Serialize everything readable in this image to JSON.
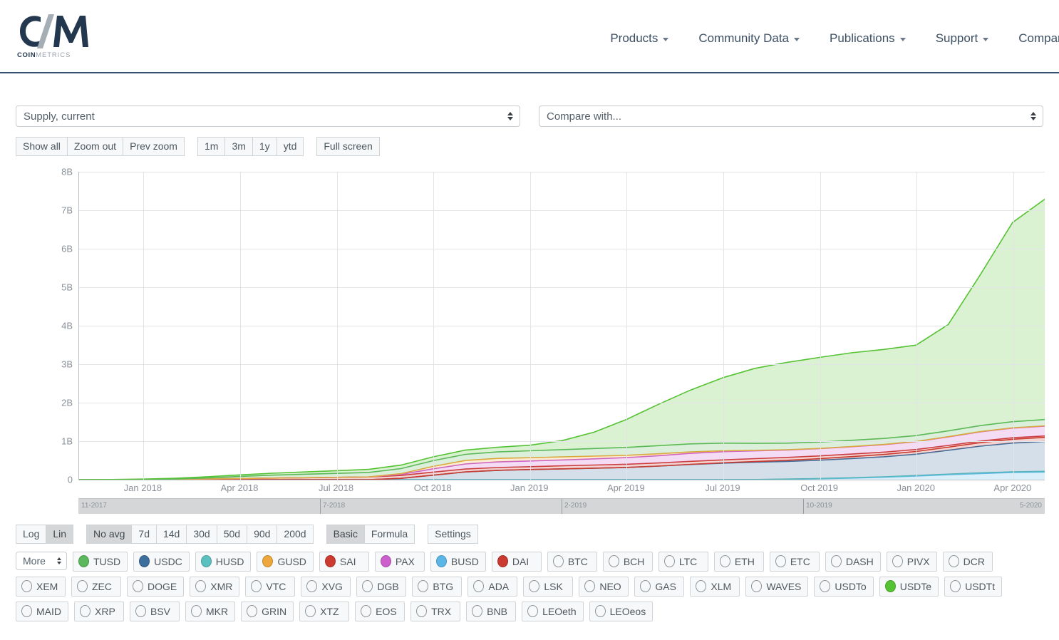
{
  "header": {
    "logo_text_bold": "COIN",
    "logo_text_light": "METRICS",
    "nav": [
      {
        "label": "Products",
        "caret": true
      },
      {
        "label": "Community Data",
        "caret": true
      },
      {
        "label": "Publications",
        "caret": true
      },
      {
        "label": "Support",
        "caret": true
      },
      {
        "label": "Company",
        "caret": true
      }
    ]
  },
  "selects": {
    "metric": {
      "value": "Supply, current",
      "name": "metric-select"
    },
    "compare": {
      "value": "Compare with...",
      "name": "compare-select"
    }
  },
  "toolbar": {
    "zoom_group": [
      "Show all",
      "Zoom out",
      "Prev zoom"
    ],
    "range_group": [
      "1m",
      "3m",
      "1y",
      "ytd"
    ],
    "fullscreen": "Full screen"
  },
  "lower_toolbar": {
    "scale_group": [
      "Log",
      "Lin"
    ],
    "scale_active": "Lin",
    "avg_group": [
      "No avg",
      "7d",
      "14d",
      "30d",
      "50d",
      "90d",
      "200d"
    ],
    "avg_active": "No avg",
    "mode_group": [
      "Basic",
      "Formula"
    ],
    "mode_active": "Basic",
    "settings": "Settings"
  },
  "asset_picker": {
    "more_label": "More",
    "rows": [
      [
        {
          "label": "TUSD",
          "active": true,
          "color": "#5cb85c"
        },
        {
          "label": "USDC",
          "active": true,
          "color": "#3d6f9e"
        },
        {
          "label": "HUSD",
          "active": true,
          "color": "#5bc0c0"
        },
        {
          "label": "GUSD",
          "active": true,
          "color": "#eda73c"
        },
        {
          "label": "SAI",
          "active": true,
          "color": "#cc3a30"
        },
        {
          "label": "PAX",
          "active": true,
          "color": "#cc5fcc"
        },
        {
          "label": "BUSD",
          "active": true,
          "color": "#5bb6e8"
        },
        {
          "label": "DAI",
          "active": true,
          "color": "#c93a30"
        },
        {
          "label": "BTC",
          "active": false,
          "color": null
        },
        {
          "label": "BCH",
          "active": false,
          "color": null
        },
        {
          "label": "LTC",
          "active": false,
          "color": null
        },
        {
          "label": "ETH",
          "active": false,
          "color": null
        },
        {
          "label": "ETC",
          "active": false,
          "color": null
        },
        {
          "label": "DASH",
          "active": false,
          "color": null
        },
        {
          "label": "PIVX",
          "active": false,
          "color": null
        },
        {
          "label": "DCR",
          "active": false,
          "color": null
        }
      ],
      [
        {
          "label": "XEM",
          "active": false,
          "color": null
        },
        {
          "label": "ZEC",
          "active": false,
          "color": null
        },
        {
          "label": "DOGE",
          "active": false,
          "color": null
        },
        {
          "label": "XMR",
          "active": false,
          "color": null
        },
        {
          "label": "VTC",
          "active": false,
          "color": null
        },
        {
          "label": "XVG",
          "active": false,
          "color": null
        },
        {
          "label": "DGB",
          "active": false,
          "color": null
        },
        {
          "label": "BTG",
          "active": false,
          "color": null
        },
        {
          "label": "ADA",
          "active": false,
          "color": null
        },
        {
          "label": "LSK",
          "active": false,
          "color": null
        },
        {
          "label": "NEO",
          "active": false,
          "color": null
        },
        {
          "label": "GAS",
          "active": false,
          "color": null
        },
        {
          "label": "XLM",
          "active": false,
          "color": null
        },
        {
          "label": "WAVES",
          "active": false,
          "color": null
        },
        {
          "label": "USDTo",
          "active": false,
          "color": null
        },
        {
          "label": "USDTe",
          "active": true,
          "color": "#55c233"
        },
        {
          "label": "USDTt",
          "active": false,
          "color": null
        }
      ],
      [
        {
          "label": "MAID",
          "active": false,
          "color": null
        },
        {
          "label": "XRP",
          "active": false,
          "color": null
        },
        {
          "label": "BSV",
          "active": false,
          "color": null
        },
        {
          "label": "MKR",
          "active": false,
          "color": null
        },
        {
          "label": "GRIN",
          "active": false,
          "color": null
        },
        {
          "label": "XTZ",
          "active": false,
          "color": null
        },
        {
          "label": "EOS",
          "active": false,
          "color": null
        },
        {
          "label": "TRX",
          "active": false,
          "color": null
        },
        {
          "label": "BNB",
          "active": false,
          "color": null
        },
        {
          "label": "LEOeth",
          "active": false,
          "color": null
        },
        {
          "label": "LEOeos",
          "active": false,
          "color": null
        }
      ]
    ]
  },
  "navigator": {
    "labels": [
      "11-2017",
      "7-2018",
      "2-2019",
      "10-2019",
      "5-2020"
    ],
    "tick_positions_pct": [
      0,
      49.5,
      99.5
    ]
  },
  "chart_data": {
    "type": "area",
    "title": "Supply, current",
    "xlabel": "",
    "ylabel": "",
    "ylim": [
      0,
      8000000000
    ],
    "ytick_labels": [
      "0",
      "1B",
      "2B",
      "3B",
      "4B",
      "5B",
      "6B",
      "7B",
      "8B"
    ],
    "ytick_values": [
      0,
      1000000000,
      2000000000,
      3000000000,
      4000000000,
      5000000000,
      6000000000,
      7000000000,
      8000000000
    ],
    "xtick_labels": [
      "Jan 2018",
      "Apr 2018",
      "Jul 2018",
      "Oct 2018",
      "Jan 2019",
      "Apr 2019",
      "Jul 2019",
      "Oct 2019",
      "Jan 2020",
      "Apr 2020"
    ],
    "grid": true,
    "legend": "chips-below",
    "stacked": true,
    "x": [
      "2017-11",
      "2017-12",
      "2018-01",
      "2018-02",
      "2018-03",
      "2018-04",
      "2018-05",
      "2018-06",
      "2018-07",
      "2018-08",
      "2018-09",
      "2018-10",
      "2018-11",
      "2018-12",
      "2019-01",
      "2019-02",
      "2019-03",
      "2019-04",
      "2019-05",
      "2019-06",
      "2019-07",
      "2019-08",
      "2019-09",
      "2019-10",
      "2019-11",
      "2019-12",
      "2020-01",
      "2020-02",
      "2020-03",
      "2020-04",
      "2020-05"
    ],
    "series": [
      {
        "name": "BUSD",
        "color": "#5bb6e8",
        "values": [
          0,
          0,
          0,
          0,
          0,
          0,
          0,
          0,
          0,
          0,
          0,
          0,
          0,
          0,
          0,
          0,
          0,
          0,
          0,
          0,
          0,
          0,
          10000000,
          20000000,
          40000000,
          60000000,
          90000000,
          130000000,
          160000000,
          190000000,
          200000000
        ]
      },
      {
        "name": "HUSD",
        "color": "#5bc0c0",
        "values": [
          0,
          0,
          0,
          0,
          0,
          0,
          0,
          0,
          0,
          0,
          0,
          0,
          0,
          0,
          0,
          0,
          0,
          0,
          0,
          0,
          0,
          0,
          5000000,
          8000000,
          10000000,
          12000000,
          14000000,
          16000000,
          18000000,
          20000000,
          20000000
        ]
      },
      {
        "name": "USDC",
        "color": "#3d6f9e",
        "values": [
          0,
          0,
          0,
          0,
          0,
          0,
          0,
          0,
          0,
          0,
          0,
          130000000,
          210000000,
          250000000,
          260000000,
          280000000,
          300000000,
          310000000,
          350000000,
          400000000,
          430000000,
          450000000,
          460000000,
          470000000,
          500000000,
          520000000,
          540000000,
          620000000,
          700000000,
          750000000,
          780000000
        ]
      },
      {
        "name": "DAI",
        "color": "#c93a30",
        "values": [
          0,
          0,
          0,
          0,
          0,
          0,
          0,
          0,
          0,
          0,
          0,
          0,
          0,
          0,
          0,
          0,
          0,
          0,
          0,
          0,
          10000000,
          20000000,
          30000000,
          40000000,
          50000000,
          60000000,
          70000000,
          80000000,
          90000000,
          100000000,
          110000000
        ]
      },
      {
        "name": "SAI",
        "color": "#cc3a30",
        "values": [
          0,
          0,
          5000000,
          10000000,
          20000000,
          30000000,
          40000000,
          50000000,
          60000000,
          70000000,
          80000000,
          80000000,
          75000000,
          70000000,
          75000000,
          80000000,
          85000000,
          82000000,
          80000000,
          78000000,
          76000000,
          75000000,
          74000000,
          72000000,
          70000000,
          60000000,
          50000000,
          45000000,
          42000000,
          40000000,
          38000000
        ]
      },
      {
        "name": "PAX",
        "color": "#cc5fcc",
        "values": [
          0,
          0,
          0,
          0,
          0,
          0,
          0,
          0,
          0,
          0,
          0,
          100000000,
          140000000,
          150000000,
          145000000,
          150000000,
          160000000,
          170000000,
          190000000,
          210000000,
          220000000,
          200000000,
          190000000,
          185000000,
          190000000,
          195000000,
          200000000,
          220000000,
          240000000,
          250000000,
          255000000
        ]
      },
      {
        "name": "GUSD",
        "color": "#eda73c",
        "values": [
          0,
          0,
          0,
          0,
          0,
          0,
          0,
          0,
          0,
          0,
          0,
          80000000,
          95000000,
          90000000,
          85000000,
          80000000,
          70000000,
          60000000,
          50000000,
          40000000,
          20000000,
          10000000,
          8000000,
          7000000,
          6000000,
          6000000,
          6000000,
          7000000,
          8000000,
          8000000,
          8000000
        ]
      },
      {
        "name": "TUSD",
        "color": "#5cb85c",
        "values": [
          0,
          0,
          0,
          0,
          20000000,
          60000000,
          80000000,
          90000000,
          100000000,
          120000000,
          130000000,
          150000000,
          160000000,
          170000000,
          180000000,
          190000000,
          200000000,
          205000000,
          210000000,
          215000000,
          200000000,
          180000000,
          170000000,
          165000000,
          160000000,
          155000000,
          150000000,
          150000000,
          155000000,
          160000000,
          165000000
        ]
      },
      {
        "name": "USDTe",
        "color": "#55c233",
        "values": [
          0,
          0,
          10000000,
          20000000,
          30000000,
          40000000,
          50000000,
          60000000,
          70000000,
          80000000,
          90000000,
          100000000,
          110000000,
          120000000,
          130000000,
          200000000,
          400000000,
          700000000,
          1100000000,
          1400000000,
          1700000000,
          2000000000,
          2100000000,
          2200000000,
          2300000000,
          2300000000,
          2350000000,
          2400000000,
          3900000000,
          5500000000,
          5800000000
        ]
      }
    ]
  }
}
